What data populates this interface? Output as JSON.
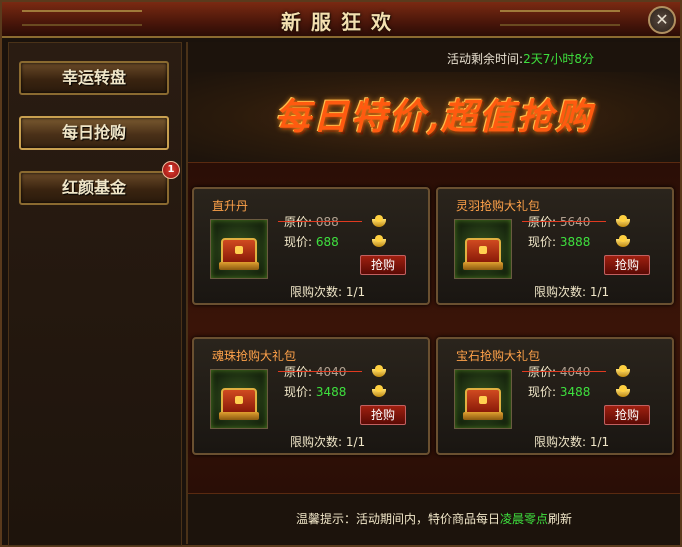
{
  "window": {
    "title": "新服狂欢",
    "close_label": "✕"
  },
  "sidebar": {
    "items": [
      {
        "label": "幸运转盘"
      },
      {
        "label": "每日抢购"
      },
      {
        "label": "红颜基金",
        "badge": "1"
      }
    ]
  },
  "timer": {
    "label": "活动剩余时间:",
    "value": "2天7小时8分"
  },
  "banner": {
    "text": "每日特价,超值抢购"
  },
  "cards": [
    {
      "name": "直升丹",
      "orig_label": "原价:",
      "orig_price": "088",
      "now_label": "现价:",
      "now_price": "688",
      "buy": "抢购",
      "limit": "限购次数: 1/1"
    },
    {
      "name": "灵羽抢购大礼包",
      "orig_label": "原价:",
      "orig_price": "5640",
      "now_label": "现价:",
      "now_price": "3888",
      "buy": "抢购",
      "limit": "限购次数: 1/1"
    },
    {
      "name": "魂珠抢购大礼包",
      "orig_label": "原价:",
      "orig_price": "4040",
      "now_label": "现价:",
      "now_price": "3488",
      "buy": "抢购",
      "limit": "限购次数: 1/1"
    },
    {
      "name": "宝石抢购大礼包",
      "orig_label": "原价:",
      "orig_price": "4040",
      "now_label": "现价:",
      "now_price": "3488",
      "buy": "抢购",
      "limit": "限购次数: 1/1"
    }
  ],
  "tip": {
    "prefix": "温馨提示：活动期间内，特价商品每日",
    "highlight": "凌晨零点",
    "suffix": "刷新"
  },
  "colors": {
    "accent_green": "#3ee03e",
    "name_orange": "#ffa24a",
    "banner_red": "#ff5a10"
  }
}
